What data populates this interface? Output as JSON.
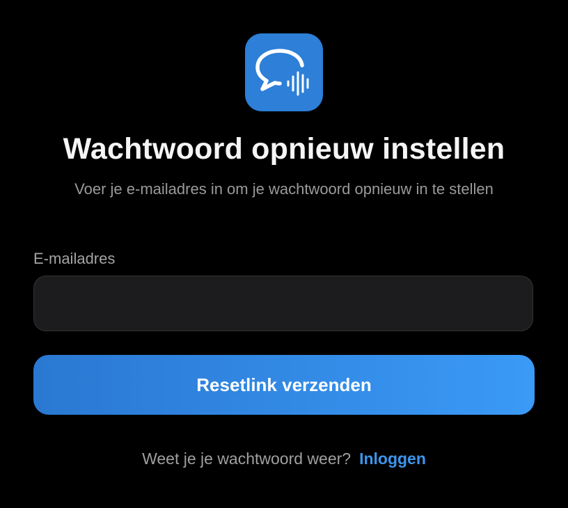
{
  "app": {
    "icon_name": "chat-voice-icon",
    "icon_color": "#2d7fd8"
  },
  "header": {
    "title": "Wachtwoord opnieuw instellen",
    "subtitle": "Voer je e-mailadres in om je wachtwoord opnieuw in te stellen"
  },
  "form": {
    "email_label": "E-mailadres",
    "email_value": "",
    "email_placeholder": "",
    "submit_label": "Resetlink verzenden"
  },
  "footer": {
    "prompt": "Weet je je wachtwoord weer?",
    "login_label": "Inloggen"
  },
  "colors": {
    "background": "#000000",
    "accent": "#3c96ee",
    "button_gradient_start": "#2a78d2",
    "button_gradient_end": "#3a9af6"
  }
}
